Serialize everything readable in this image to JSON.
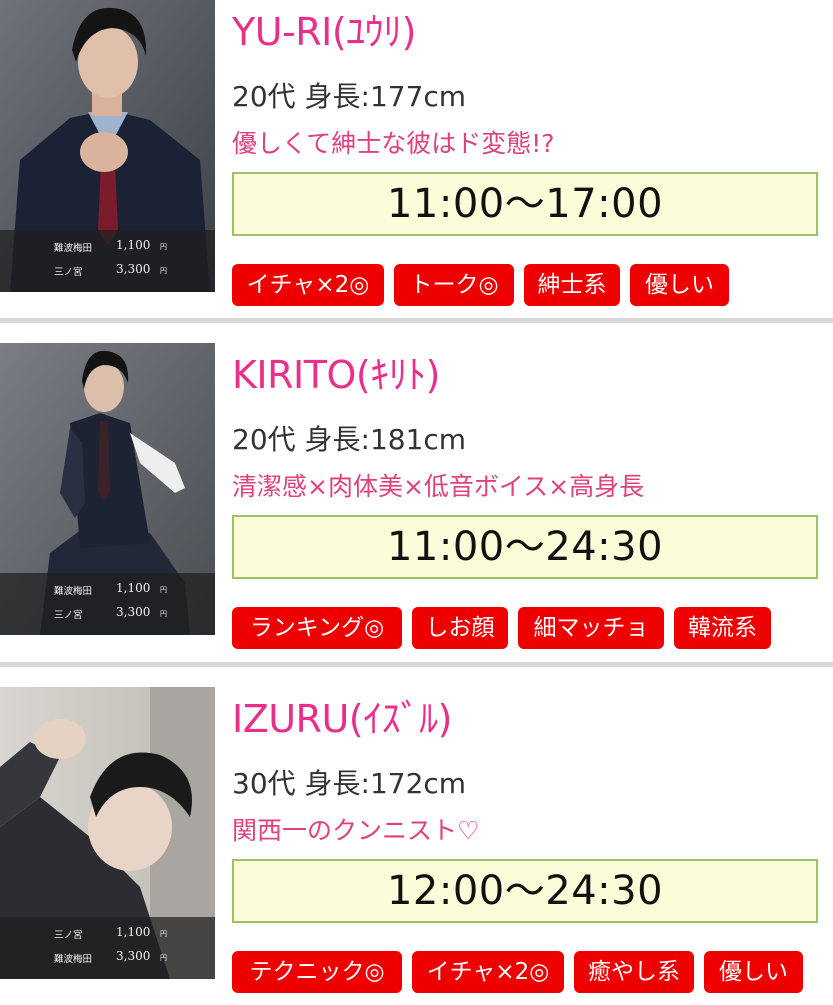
{
  "cards": [
    {
      "name": "YU-RI(ﾕｳﾘ)",
      "spec": "20代 身長:177cm",
      "catch": "優しくて紳士な彼はド変態!?",
      "time": "11:00〜17:00",
      "prices": [
        {
          "area": "難波梅田",
          "price": "1,100",
          "unit": "円"
        },
        {
          "area": "三ノ宮",
          "price": "3,300",
          "unit": "円"
        }
      ],
      "tags": [
        "イチャ×2◎",
        "トーク◎",
        "紳士系",
        "優しい"
      ]
    },
    {
      "name": "KIRITO(ｷﾘﾄ)",
      "spec": "20代 身長:181cm",
      "catch": "清潔感×肉体美×低音ボイス×高身長",
      "time": "11:00〜24:30",
      "prices": [
        {
          "area": "難波梅田",
          "price": "1,100",
          "unit": "円"
        },
        {
          "area": "三ノ宮",
          "price": "3,300",
          "unit": "円"
        }
      ],
      "tags": [
        "ランキング◎",
        "しお顔",
        "細マッチョ",
        "韓流系"
      ]
    },
    {
      "name": "IZURU(ｲｽﾞﾙ)",
      "spec": "30代 身長:172cm",
      "catch": "関西一のクンニスト♡",
      "time": "12:00〜24:30",
      "prices": [
        {
          "area": "三ノ宮",
          "price": "1,100",
          "unit": "円"
        },
        {
          "area": "難波梅田",
          "price": "3,300",
          "unit": "円"
        }
      ],
      "tags": [
        "テクニック◎",
        "イチャ×2◎",
        "癒やし系",
        "優しい"
      ]
    }
  ],
  "colors": {
    "name": "#e8308a",
    "catch": "#e0407e",
    "tag_bg": "#ee0000",
    "time_bg": "#fdfcd8",
    "time_border": "#9cc26a"
  }
}
